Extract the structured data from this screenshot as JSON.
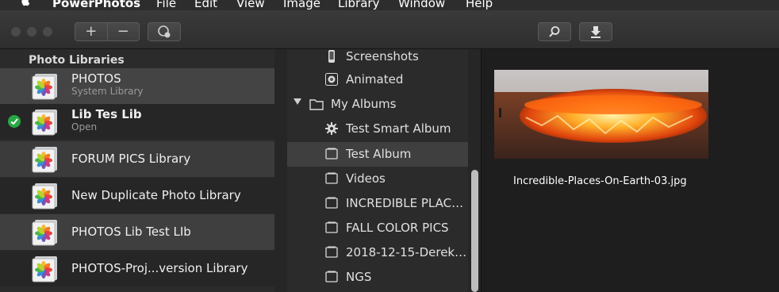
{
  "menubar": {
    "app_name": "PowerPhotos",
    "items": [
      "File",
      "Edit",
      "View",
      "Image",
      "Library",
      "Window",
      "Help"
    ]
  },
  "toolbar": {
    "add_label": "+",
    "remove_label": "−"
  },
  "left_pane": {
    "header": "Photo Libraries",
    "libraries": [
      {
        "name": "PHOTOS",
        "sub": "System Library",
        "bold": false,
        "checked": false
      },
      {
        "name": "Lib Tes Lib",
        "sub": "Open",
        "bold": true,
        "checked": true
      },
      {
        "name": "FORUM PICS Library",
        "sub": "",
        "bold": false,
        "checked": false
      },
      {
        "name": "New Duplicate Photo Library",
        "sub": "",
        "bold": false,
        "checked": false
      },
      {
        "name": "PHOTOS Lib Test LIb",
        "sub": "",
        "bold": false,
        "checked": false
      },
      {
        "name": "PHOTOS-Proj...version Library",
        "sub": "",
        "bold": false,
        "checked": false
      }
    ]
  },
  "middle_pane": {
    "items": [
      {
        "label": "Screenshots",
        "icon": "phone-icon"
      },
      {
        "label": "Animated",
        "icon": "animated-icon"
      },
      {
        "label": "My Albums",
        "icon": "folder-icon",
        "disclosure": true
      },
      {
        "label": "Test Smart Album",
        "icon": "gear-icon"
      },
      {
        "label": "Test Album",
        "icon": "album-icon",
        "selected": true
      },
      {
        "label": "Videos",
        "icon": "album-icon"
      },
      {
        "label": "INCREDIBLE PLAC…",
        "icon": "album-icon"
      },
      {
        "label": "FALL COLOR PICS",
        "icon": "album-icon"
      },
      {
        "label": "2018-12-15-Derek…",
        "icon": "album-icon"
      },
      {
        "label": "NGS",
        "icon": "album-icon"
      }
    ]
  },
  "right_pane": {
    "photo_caption": "Incredible-Places-On-Earth-03.jpg"
  },
  "colors": {
    "selected_row": "#3f3f3f",
    "check_green": "#28a745",
    "accent_orange": "#ff8a1f"
  }
}
